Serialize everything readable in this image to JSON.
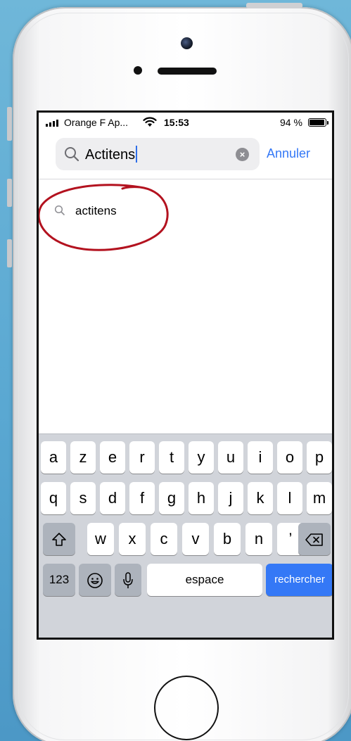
{
  "status_bar": {
    "carrier": "Orange F Ap...",
    "time": "15:53",
    "battery_percent": "94 %",
    "battery_level": 0.94
  },
  "search": {
    "query": "Actitens",
    "cancel_label": "Annuler"
  },
  "suggestions": [
    {
      "label": "actitens"
    }
  ],
  "keyboard": {
    "row1": [
      "a",
      "z",
      "e",
      "r",
      "t",
      "y",
      "u",
      "i",
      "o",
      "p"
    ],
    "row2": [
      "q",
      "s",
      "d",
      "f",
      "g",
      "h",
      "j",
      "k",
      "l",
      "m"
    ],
    "row3": [
      "w",
      "x",
      "c",
      "v",
      "b",
      "n",
      "’"
    ],
    "numbers_label": "123",
    "space_label": "espace",
    "search_label": "rechercher"
  },
  "colors": {
    "accent": "#3478f6",
    "annotation": "#b3121f",
    "keyboard_bg": "#d1d4da"
  }
}
